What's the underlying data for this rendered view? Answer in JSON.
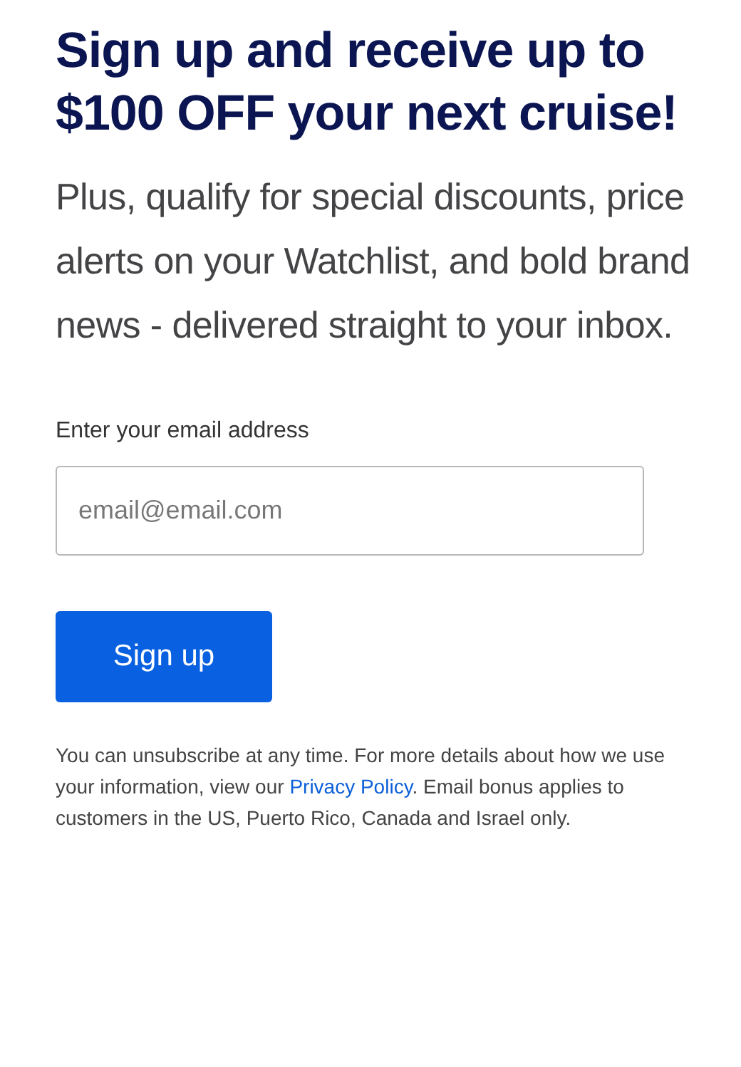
{
  "heading": "Sign up and receive up to $100 OFF your next cruise!",
  "subheading": "Plus, qualify for special discounts, price alerts on your Watchlist, and bold brand news - delivered straight to your inbox.",
  "email_field": {
    "label": "Enter your email address",
    "placeholder": "email@email.com"
  },
  "submit_button": "Sign up",
  "disclaimer": {
    "before": "You can unsubscribe at any time. For more details about how we use your information, view our",
    "link": "Privacy Policy",
    "after": ". Email bonus applies to customers in the US, Puerto Rico, Canada and Israel only."
  }
}
